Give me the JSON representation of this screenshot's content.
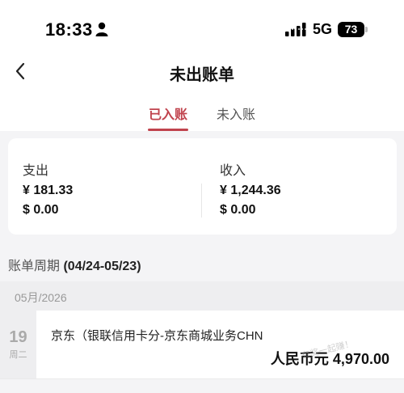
{
  "status_bar": {
    "time": "18:33",
    "network": "5G",
    "battery": "73",
    "icons": [
      "person-icon",
      "signal-icon",
      "battery-icon"
    ]
  },
  "nav": {
    "title": "未出账单",
    "back_icon": "chevron-left-icon"
  },
  "tabs": [
    {
      "label": "已入账",
      "active": true
    },
    {
      "label": "未入账",
      "active": false
    }
  ],
  "summary": {
    "expense": {
      "label": "支出",
      "cny": "¥ 181.33",
      "usd": "$ 0.00"
    },
    "income": {
      "label": "收入",
      "cny": "¥ 1,244.36",
      "usd": "$ 0.00"
    }
  },
  "period": {
    "label": "账单周期",
    "range": "(04/24-05/23)"
  },
  "month_group": "05月/2026",
  "transactions": [
    {
      "day": "19",
      "weekday": "周二",
      "merchant": "京东（银联信用卡分-京东商城业务CHN",
      "amount": "人民币元 4,970.00"
    }
  ],
  "watermark": "有奖一起赚！",
  "colors": {
    "accent": "#c0434d",
    "background": "#f4f4f6",
    "card": "#ffffff",
    "date_column": "#eeeef0"
  }
}
